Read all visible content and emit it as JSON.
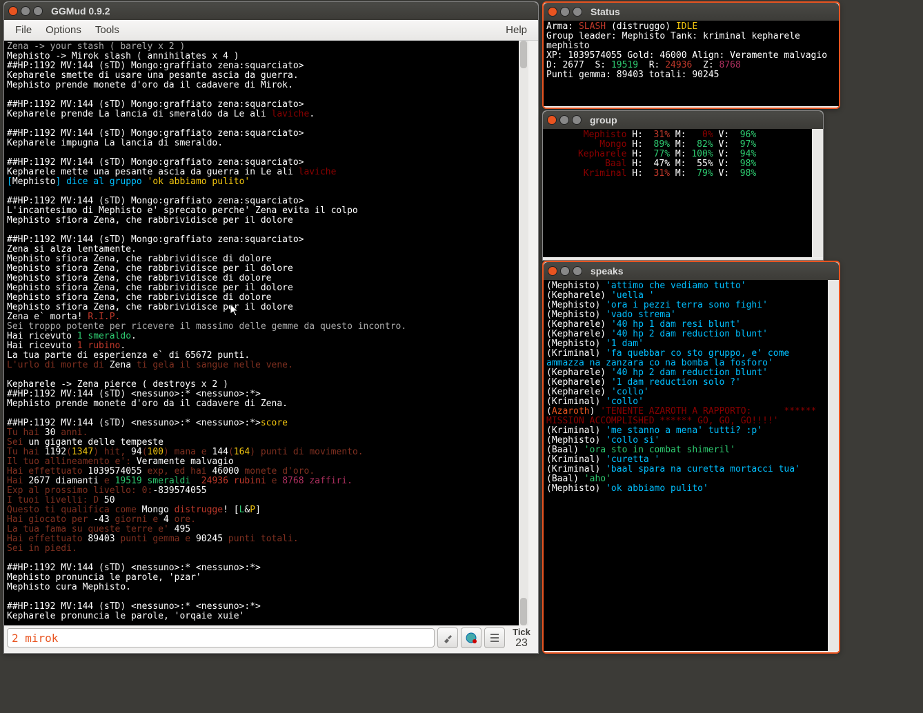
{
  "main": {
    "title": "GGMud 0.9.2",
    "menu": {
      "file": "File",
      "options": "Options",
      "tools": "Tools",
      "help": "Help"
    },
    "tick": {
      "label": "Tick",
      "value": "23"
    },
    "input_value": "2 mirok"
  },
  "status": {
    "title": "Status",
    "arma_lbl": "Arma:",
    "arma_val": "SLASH",
    "arma_paren": "(distruggo)",
    "idle": "IDLE",
    "gl_lbl": "Group leader:",
    "gl_val": "Mephisto",
    "tank_lbl": "Tank:",
    "tank_val": "kriminal kepharele mephisto",
    "xp_lbl": "XP:",
    "xp_val": "1039574055",
    "gold_lbl": "Gold:",
    "gold_val": "46000",
    "align_lbl": "Align:",
    "align_val": "Veramente malvagio",
    "d_lbl": "D:",
    "d_val": "2677",
    "s_lbl": "S:",
    "s_val": "19519",
    "r_lbl": "R:",
    "r_val": "24936",
    "z_lbl": "Z:",
    "z_val": "8768",
    "pg_lbl": "Punti gemma:",
    "pg_val": "89403",
    "tot_lbl": "totali:",
    "tot_val": "90245"
  },
  "group": {
    "title": "group",
    "rows": [
      {
        "name": "Mephisto",
        "nc": "c-darkred",
        "h": "31%",
        "hc": "c-red",
        "m": "0%",
        "mc": "c-darkred",
        "v": "96%",
        "vc": "c-green"
      },
      {
        "name": "Mongo",
        "nc": "c-darkred",
        "h": "89%",
        "hc": "c-green",
        "m": "82%",
        "mc": "c-green",
        "v": "97%",
        "vc": "c-green"
      },
      {
        "name": "Kepharele",
        "nc": "c-darkred",
        "h": "77%",
        "hc": "c-green",
        "m": "100%",
        "mc": "c-green",
        "v": "94%",
        "vc": "c-green"
      },
      {
        "name": "Baal",
        "nc": "c-darkred",
        "h": "47%",
        "hc": "c-white",
        "m": "55%",
        "mc": "c-white",
        "v": "98%",
        "vc": "c-green"
      },
      {
        "name": "Kriminal",
        "nc": "c-darkred",
        "h": "31%",
        "hc": "c-red",
        "m": "79%",
        "mc": "c-green",
        "v": "98%",
        "vc": "c-green"
      }
    ]
  },
  "speaks": {
    "title": "speaks",
    "lines": [
      {
        "who": "Mephisto",
        "wc": "c-white",
        "txt": "'attimo che vediamo tutto'",
        "tc": "c-blue"
      },
      {
        "who": "Kepharele",
        "wc": "c-white",
        "txt": "'uella '",
        "tc": "c-blue"
      },
      {
        "who": "Mephisto",
        "wc": "c-white",
        "txt": "'ora i pezzi terra sono fighi'",
        "tc": "c-blue"
      },
      {
        "who": "Mephisto",
        "wc": "c-white",
        "txt": "'vado strema'",
        "tc": "c-blue"
      },
      {
        "who": "Kepharele",
        "wc": "c-white",
        "txt": "'40 hp 1 dam resi blunt'",
        "tc": "c-blue"
      },
      {
        "who": "Kepharele",
        "wc": "c-white",
        "txt": "'40 hp 2 dam reduction blunt'",
        "tc": "c-blue"
      },
      {
        "who": "Mephisto",
        "wc": "c-white",
        "txt": "'1 dam'",
        "tc": "c-blue"
      },
      {
        "who": "Kriminal",
        "wc": "c-white",
        "txt": "'fa quebbar co sto gruppo, e' come ammazza na zanzara co na bomba la fosforo'",
        "tc": "c-blue"
      },
      {
        "who": "Kepharele",
        "wc": "c-white",
        "txt": "'40 hp 2 dam reduction blunt'",
        "tc": "c-blue"
      },
      {
        "who": "Kepharele",
        "wc": "c-white",
        "txt": "'1 dam reduction solo ?'",
        "tc": "c-blue"
      },
      {
        "who": "Kepharele",
        "wc": "c-white",
        "txt": "'collo'",
        "tc": "c-blue"
      },
      {
        "who": "Kriminal",
        "wc": "c-white",
        "txt": "'collo'",
        "tc": "c-blue"
      },
      {
        "who": "Azaroth",
        "wc": "c-orange",
        "txt": "'TENENTE AZAROTH A RAPPORTO:      ****** MISSION ACCOMPLISHED ****** GO, GO, GO!!!!'",
        "tc": "c-darkred"
      },
      {
        "who": "Kriminal",
        "wc": "c-white",
        "txt": "'me stanno a mena' tutti? :p'",
        "tc": "c-blue"
      },
      {
        "who": "Mephisto",
        "wc": "c-white",
        "txt": "'collo si'",
        "tc": "c-blue"
      },
      {
        "who": "Baal",
        "wc": "c-white",
        "txt": "'ora sto in combat shimeril'",
        "tc": "c-green"
      },
      {
        "who": "Kriminal",
        "wc": "c-white",
        "txt": "'curetta '",
        "tc": "c-blue"
      },
      {
        "who": "Kriminal",
        "wc": "c-white",
        "txt": "'baal spara na curetta mortacci tua'",
        "tc": "c-blue"
      },
      {
        "who": "Baal",
        "wc": "c-white",
        "txt": "'aho'",
        "tc": "c-green"
      },
      {
        "who": "Mephisto",
        "wc": "c-white",
        "txt": "'ok abbiamo pulito'",
        "tc": "c-blue"
      }
    ]
  },
  "log": {
    "segs": [
      [
        {
          "t": "Zena -> your stash ( barely x 2 )",
          "c": "c-grey"
        }
      ],
      [
        {
          "t": "Mephisto -> Mirok slash ( annihilates x 4 )",
          "c": "c-white"
        }
      ],
      [
        {
          "t": "##HP:1192 MV:144 (sTD) Mongo:graffiato zena:squarciato>",
          "c": "c-white"
        }
      ],
      [
        {
          "t": "Kepharele smette di usare una pesante ascia da guerra.",
          "c": "c-white"
        }
      ],
      [
        {
          "t": "Mephisto prende monete d'oro da il cadavere di Mirok.",
          "c": "c-white"
        }
      ],
      [
        {
          "t": "",
          "c": "c-white"
        }
      ],
      [
        {
          "t": "##HP:1192 MV:144 (sTD) Mongo:graffiato zena:squarciato>",
          "c": "c-white"
        }
      ],
      [
        {
          "t": "Kepharele prende La lancia di smeraldo da ",
          "c": "c-white"
        },
        {
          "t": "Le ali ",
          "c": "c-white"
        },
        {
          "t": "laviche",
          "c": "c-darkred"
        },
        {
          "t": ".",
          "c": "c-white"
        }
      ],
      [
        {
          "t": "",
          "c": "c-white"
        }
      ],
      [
        {
          "t": "##HP:1192 MV:144 (sTD) Mongo:graffiato zena:squarciato>",
          "c": "c-white"
        }
      ],
      [
        {
          "t": "Kepharele impugna La lancia di smeraldo.",
          "c": "c-white"
        }
      ],
      [
        {
          "t": "",
          "c": "c-white"
        }
      ],
      [
        {
          "t": "##HP:1192 MV:144 (sTD) Mongo:graffiato zena:squarciato>",
          "c": "c-white"
        }
      ],
      [
        {
          "t": "Kepharele mette una pesante ascia da guerra in ",
          "c": "c-white"
        },
        {
          "t": "Le ali ",
          "c": "c-white"
        },
        {
          "t": "laviche",
          "c": "c-darkred"
        }
      ],
      [
        {
          "t": "[",
          "c": "c-blue"
        },
        {
          "t": "Mephisto",
          "c": "c-white"
        },
        {
          "t": "] ",
          "c": "c-blue"
        },
        {
          "t": "dice al gruppo ",
          "c": "c-blue"
        },
        {
          "t": "'ok abbiamo pulito'",
          "c": "c-yellow"
        }
      ],
      [
        {
          "t": "",
          "c": "c-white"
        }
      ],
      [
        {
          "t": "##HP:1192 MV:144 (sTD) Mongo:graffiato zena:squarciato>",
          "c": "c-white"
        }
      ],
      [
        {
          "t": "L'incantesimo di Mephisto e' sprecato perche' Zena evita il colpo",
          "c": "c-white"
        }
      ],
      [
        {
          "t": "Mephisto sfiora Zena, che rabbrividisce per il dolore",
          "c": "c-white"
        }
      ],
      [
        {
          "t": "",
          "c": "c-white"
        }
      ],
      [
        {
          "t": "##HP:1192 MV:144 (sTD) Mongo:graffiato zena:squarciato>",
          "c": "c-white"
        }
      ],
      [
        {
          "t": "Zena si alza lentamente.",
          "c": "c-white"
        }
      ],
      [
        {
          "t": "Mephisto sfiora Zena, che rabbrividisce di dolore",
          "c": "c-white"
        }
      ],
      [
        {
          "t": "Mephisto sfiora Zena, che rabbrividisce per il dolore",
          "c": "c-white"
        }
      ],
      [
        {
          "t": "Mephisto sfiora Zena, che rabbrividisce di dolore",
          "c": "c-white"
        }
      ],
      [
        {
          "t": "Mephisto sfiora Zena, che rabbrividisce per il dolore",
          "c": "c-white"
        }
      ],
      [
        {
          "t": "Mephisto sfiora Zena, che rabbrividisce di dolore",
          "c": "c-white"
        }
      ],
      [
        {
          "t": "Mephisto sfiora Zena, che rabbrividisce per il dolore",
          "c": "c-white"
        }
      ],
      [
        {
          "t": "Zena e` morta! ",
          "c": "c-white"
        },
        {
          "t": "R.I.P.",
          "c": "c-red"
        }
      ],
      [
        {
          "t": "Sei troppo potente per ricevere il massimo delle gemme da questo incontro.",
          "c": "c-grey"
        }
      ],
      [
        {
          "t": "Hai ricevuto ",
          "c": "c-white"
        },
        {
          "t": "1 smeraldo",
          "c": "c-green"
        },
        {
          "t": ".",
          "c": "c-white"
        }
      ],
      [
        {
          "t": "Hai ricevuto ",
          "c": "c-white"
        },
        {
          "t": "1 rubino",
          "c": "c-red"
        },
        {
          "t": ".",
          "c": "c-white"
        }
      ],
      [
        {
          "t": "La tua parte di esperienza e` di 65672 punti.",
          "c": "c-white"
        }
      ],
      [
        {
          "t": "L'urlo di morte di ",
          "c": "c-dimred"
        },
        {
          "t": "Zena",
          "c": "c-white"
        },
        {
          "t": " ti gela il sangue nelle vene.",
          "c": "c-dimred"
        }
      ],
      [
        {
          "t": "",
          "c": "c-white"
        }
      ],
      [
        {
          "t": "Kepharele -> Zena pierce ( destroys x 2 )",
          "c": "c-white"
        }
      ],
      [
        {
          "t": "##HP:1192 MV:144 (sTD) <nessuno>:* <nessuno>:*>",
          "c": "c-white"
        }
      ],
      [
        {
          "t": "Mephisto prende monete d'oro da il cadavere di Zena.",
          "c": "c-white"
        }
      ],
      [
        {
          "t": "",
          "c": "c-white"
        }
      ],
      [
        {
          "t": "##HP:1192 MV:144 (sTD) <nessuno>:* <nessuno>:*>",
          "c": "c-white"
        },
        {
          "t": "score",
          "c": "c-yellow"
        }
      ],
      [
        {
          "t": "Tu hai ",
          "c": "c-dimred"
        },
        {
          "t": "30",
          "c": "c-white"
        },
        {
          "t": " anni.",
          "c": "c-dimred"
        }
      ],
      [
        {
          "t": "Sei ",
          "c": "c-dimred"
        },
        {
          "t": "un gigante delle tempeste",
          "c": "c-white"
        }
      ],
      [
        {
          "t": "Tu hai ",
          "c": "c-dimred"
        },
        {
          "t": "1192",
          "c": "c-white"
        },
        {
          "t": "(",
          "c": "c-dimred"
        },
        {
          "t": "1347",
          "c": "c-yellow"
        },
        {
          "t": ") hit, ",
          "c": "c-dimred"
        },
        {
          "t": "94",
          "c": "c-white"
        },
        {
          "t": "(",
          "c": "c-dimred"
        },
        {
          "t": "100",
          "c": "c-yellow"
        },
        {
          "t": ") mana e ",
          "c": "c-dimred"
        },
        {
          "t": "144",
          "c": "c-white"
        },
        {
          "t": "(",
          "c": "c-dimred"
        },
        {
          "t": "164",
          "c": "c-yellow"
        },
        {
          "t": ") punti di movimento.",
          "c": "c-dimred"
        }
      ],
      [
        {
          "t": "Il tuo allineamento e': ",
          "c": "c-dimred"
        },
        {
          "t": "Veramente malvagio",
          "c": "c-white"
        }
      ],
      [
        {
          "t": "Hai effettuato ",
          "c": "c-dimred"
        },
        {
          "t": "1039574055",
          "c": "c-white"
        },
        {
          "t": " exp, ed hai ",
          "c": "c-dimred"
        },
        {
          "t": "46000",
          "c": "c-white"
        },
        {
          "t": " monete d'oro.",
          "c": "c-dimred"
        }
      ],
      [
        {
          "t": "Hai ",
          "c": "c-dimred"
        },
        {
          "t": "2677",
          "c": "c-white"
        },
        {
          "t": " diamanti ",
          "c": "c-white"
        },
        {
          "t": "e ",
          "c": "c-dimred"
        },
        {
          "t": "19519",
          "c": "c-green"
        },
        {
          "t": " smeraldi  ",
          "c": "c-green"
        },
        {
          "t": "24936",
          "c": "c-red"
        },
        {
          "t": " rubini ",
          "c": "c-red"
        },
        {
          "t": "e ",
          "c": "c-dimred"
        },
        {
          "t": "8768 zaffiri.",
          "c": "c-dkmag"
        }
      ],
      [
        {
          "t": "Exp al prossimo livello: 0:",
          "c": "c-dimred"
        },
        {
          "t": "-839574055",
          "c": "c-white"
        }
      ],
      [
        {
          "t": "I tuoi livelli: D ",
          "c": "c-dimred"
        },
        {
          "t": "50",
          "c": "c-white"
        }
      ],
      [
        {
          "t": "Questo ti qualifica come ",
          "c": "c-dimred"
        },
        {
          "t": "Mongo ",
          "c": "c-white"
        },
        {
          "t": "distrugge",
          "c": "c-red"
        },
        {
          "t": "! [",
          "c": "c-white"
        },
        {
          "t": "L",
          "c": "c-green"
        },
        {
          "t": "&",
          "c": "c-white"
        },
        {
          "t": "P",
          "c": "c-yellow"
        },
        {
          "t": "]",
          "c": "c-white"
        }
      ],
      [
        {
          "t": "Hai giocato per ",
          "c": "c-dimred"
        },
        {
          "t": "-43",
          "c": "c-white"
        },
        {
          "t": " giorni e ",
          "c": "c-dimred"
        },
        {
          "t": "4",
          "c": "c-white"
        },
        {
          "t": " ore.",
          "c": "c-dimred"
        }
      ],
      [
        {
          "t": "La tua fama su queste terre e' ",
          "c": "c-dimred"
        },
        {
          "t": "495",
          "c": "c-white"
        }
      ],
      [
        {
          "t": "Hai effettuato ",
          "c": "c-dimred"
        },
        {
          "t": "89403",
          "c": "c-white"
        },
        {
          "t": " punti gemma e ",
          "c": "c-dimred"
        },
        {
          "t": "90245",
          "c": "c-white"
        },
        {
          "t": " punti totali.",
          "c": "c-dimred"
        }
      ],
      [
        {
          "t": "Sei in piedi.",
          "c": "c-dimred"
        }
      ],
      [
        {
          "t": "",
          "c": "c-white"
        }
      ],
      [
        {
          "t": "##HP:1192 MV:144 (sTD) <nessuno>:* <nessuno>:*>",
          "c": "c-white"
        }
      ],
      [
        {
          "t": "Mephisto pronuncia le parole, 'pzar'",
          "c": "c-white"
        }
      ],
      [
        {
          "t": "Mephisto cura Mephisto.",
          "c": "c-white"
        }
      ],
      [
        {
          "t": "",
          "c": "c-white"
        }
      ],
      [
        {
          "t": "##HP:1192 MV:144 (sTD) <nessuno>:* <nessuno>:*>",
          "c": "c-white"
        }
      ],
      [
        {
          "t": "Kepharele pronuncia le parole, 'orqaie xuie'",
          "c": "c-white"
        }
      ],
      [
        {
          "t": "",
          "c": "c-white"
        }
      ],
      [
        {
          "t": "##HP:1192 MV:144 (sTD) <nessuno>:* <nessuno>:*>",
          "c": "c-white"
        }
      ]
    ]
  }
}
